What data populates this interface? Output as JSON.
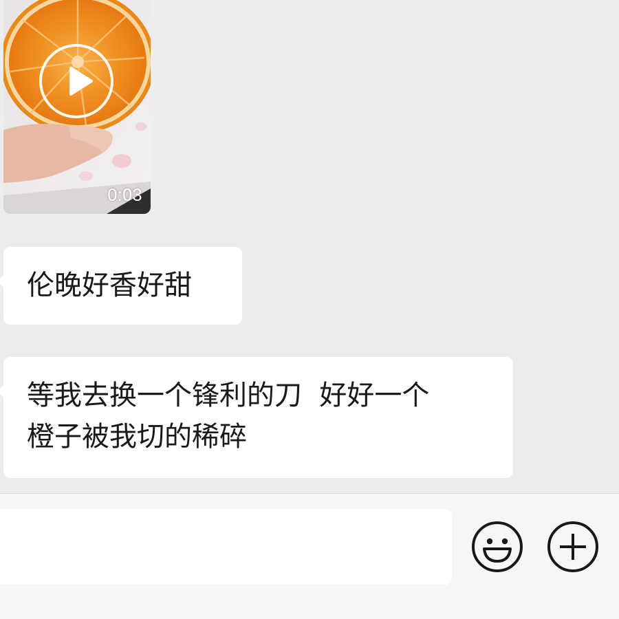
{
  "messages": {
    "video": {
      "duration": "0:03"
    },
    "text_1": "伦晚好香好甜",
    "text_2_line_1": "等我去换一个锋利的刀  好好一个",
    "text_2_line_2": "橙子被我切的稀碎"
  },
  "input_bar": {
    "value": "",
    "emoji_icon": "smiley-face-icon",
    "more_icon": "plus-circle-icon"
  },
  "colors": {
    "chat_background": "#ededed",
    "bubble_background": "#ffffff",
    "text": "#191919",
    "input_bar_background": "#f6f6f6",
    "icon_stroke": "#181818"
  }
}
